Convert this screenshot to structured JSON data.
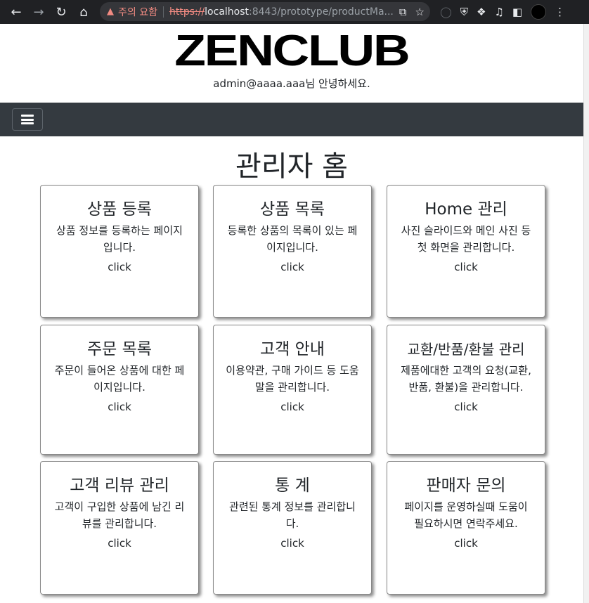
{
  "browser": {
    "warning": "주의 요함",
    "url_scheme": "https://",
    "url_host": "localhost",
    "url_path": ":8443/prototype/productMa..."
  },
  "header": {
    "logo": "ZENCLUB",
    "greeting": "admin@aaaa.aaa님 안녕하세요."
  },
  "page_title": "관리자 홈",
  "cards": [
    {
      "title": "상품 등록",
      "desc": "상품 정보를 등록하는 페이지입니다.",
      "link": "click"
    },
    {
      "title": "상품 목록",
      "desc": "등록한 상품의 목록이 있는 페이지입니다.",
      "link": "click"
    },
    {
      "title": "Home 관리",
      "desc": "사진 슬라이드와 메인 사진 등 첫 화면을 관리합니다.",
      "link": "click"
    },
    {
      "title": "주문 목록",
      "desc": "주문이 들어온 상품에 대한 페이지입니다.",
      "link": "click"
    },
    {
      "title": "고객 안내",
      "desc": "이용약관, 구매 가이드 등 도움말을 관리합니다.",
      "link": "click"
    },
    {
      "title": "교환/반품/환불 관리",
      "desc": "제품에대한 고객의 요청(교환, 반품, 환불)을 관리합니다.",
      "link": "click"
    },
    {
      "title": "고객 리뷰 관리",
      "desc": "고객이 구입한 상품에 남긴 리뷰를 관리합니다.",
      "link": "click"
    },
    {
      "title": "통 계",
      "desc": "관련된 통계 정보를 관리합니다.",
      "link": "click"
    },
    {
      "title": "판매자 문의",
      "desc": "페이지를 운영하실때 도움이 필요하시면 연락주세요.",
      "link": "click"
    }
  ]
}
